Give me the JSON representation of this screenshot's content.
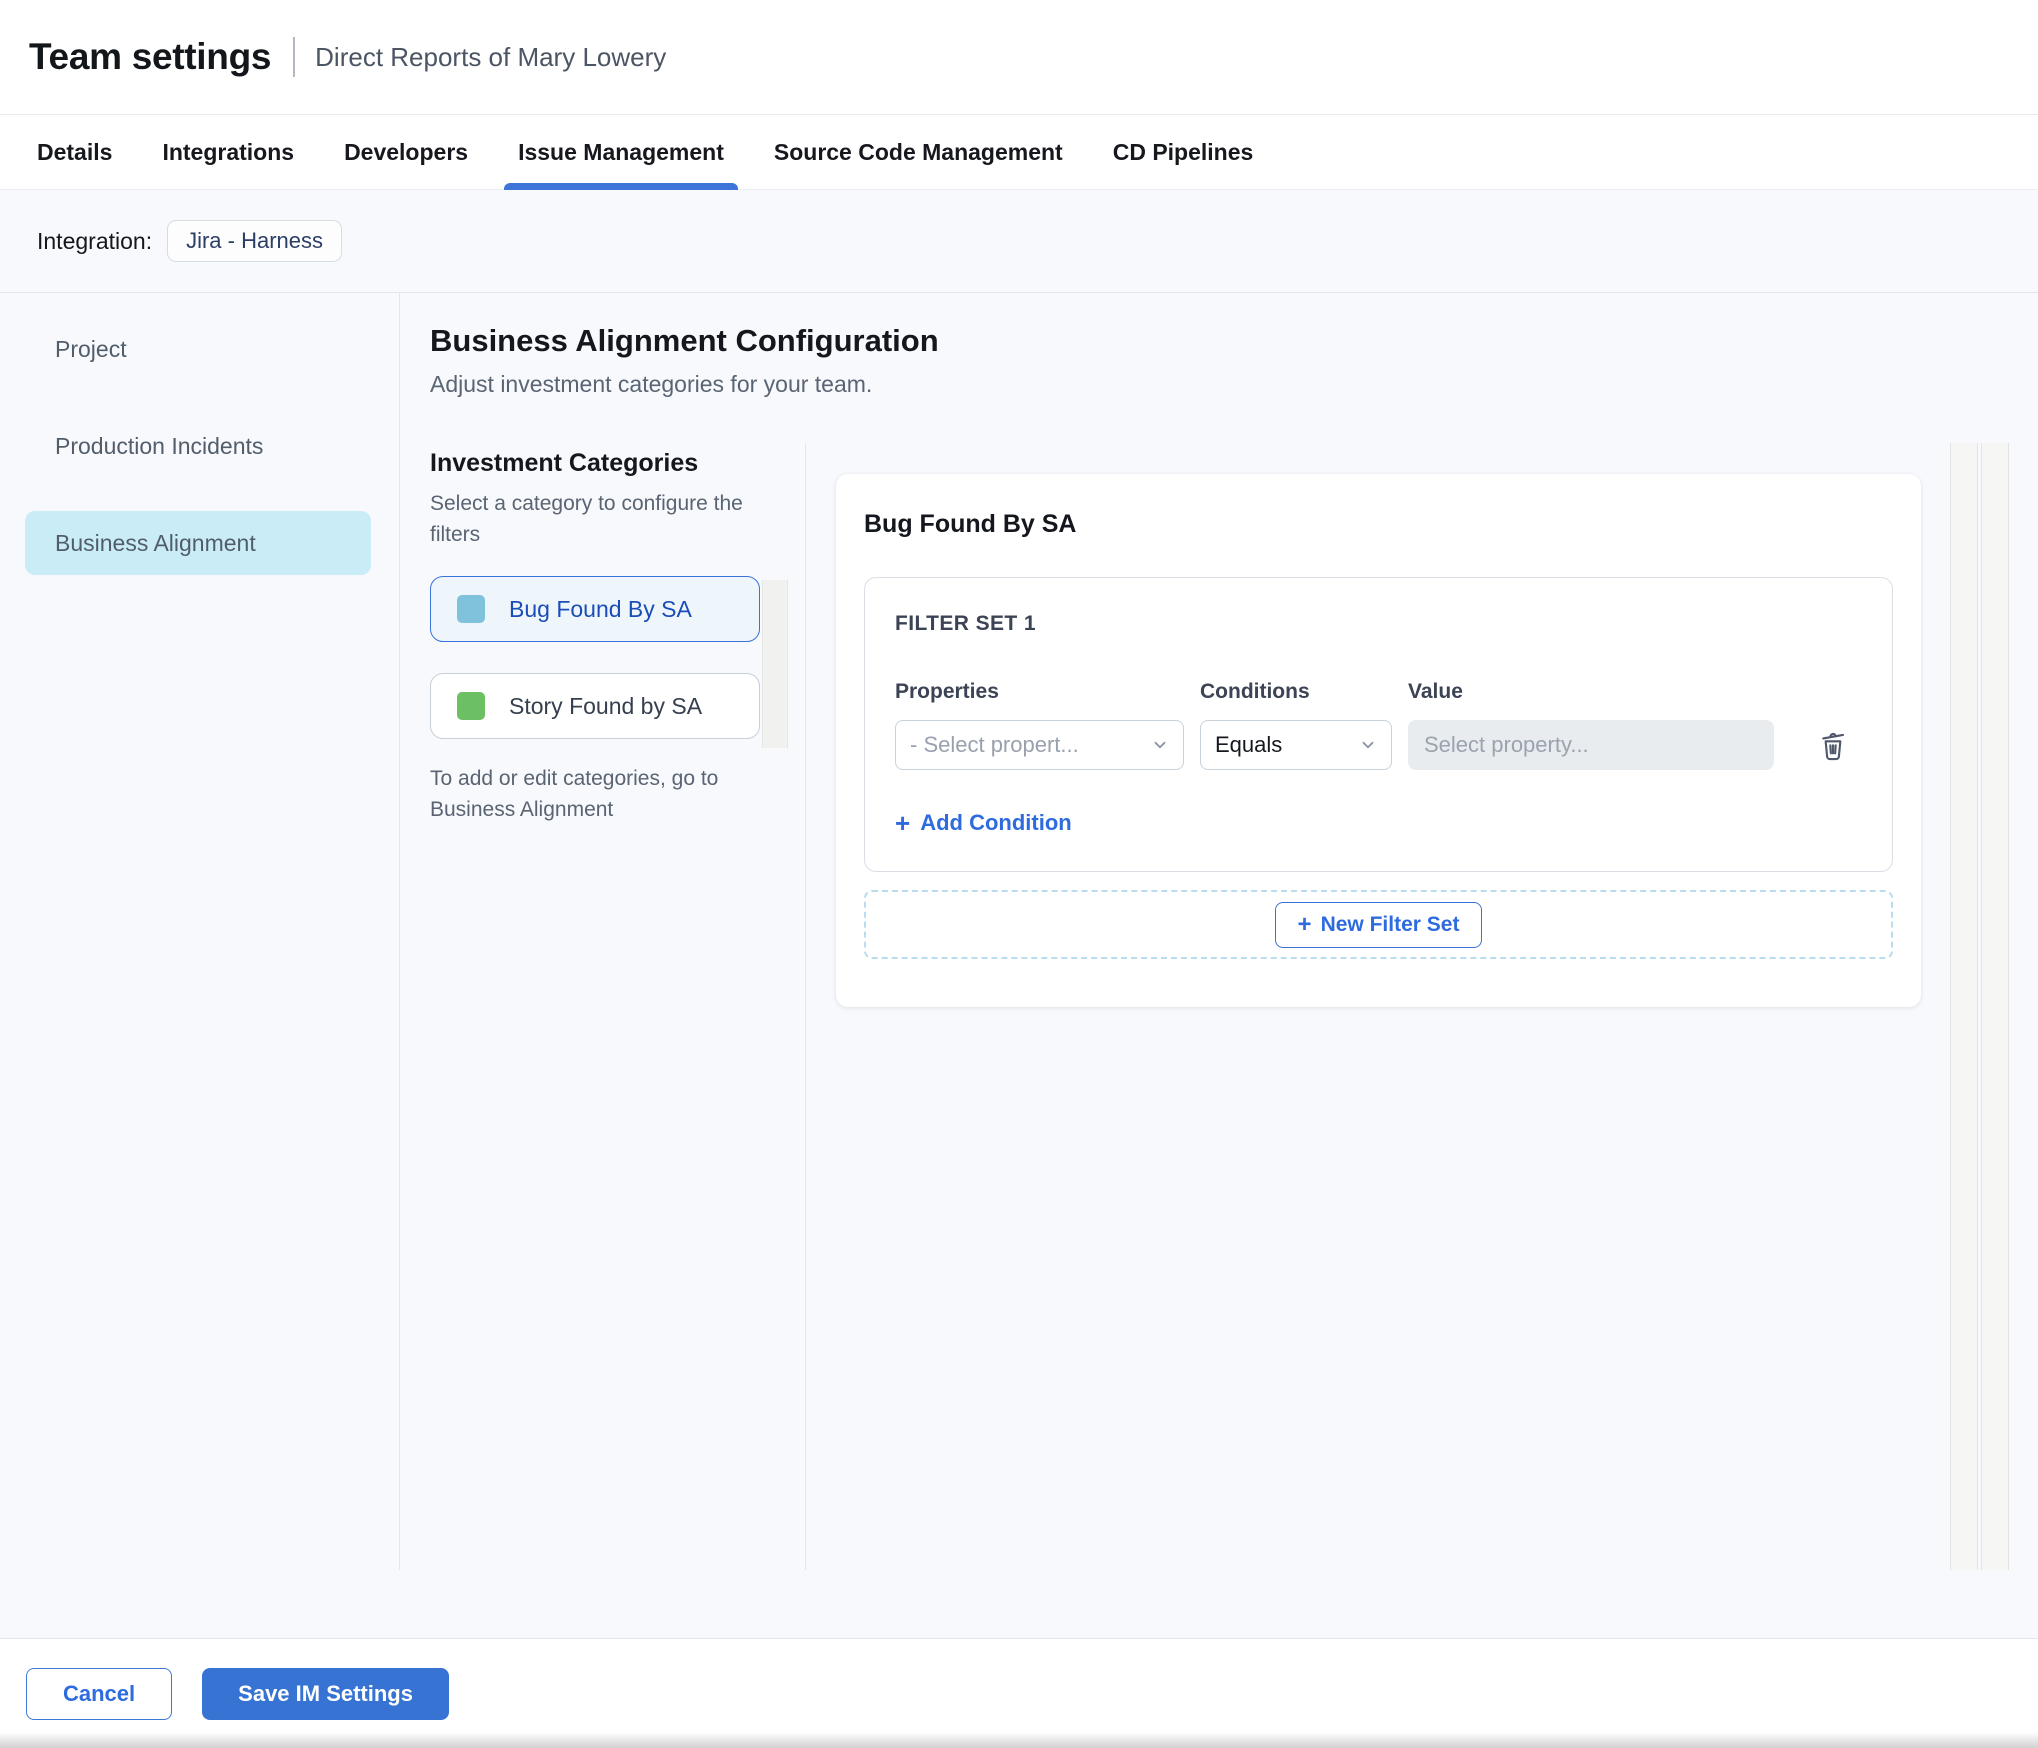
{
  "header": {
    "title": "Team settings",
    "subtitle": "Direct Reports of Mary Lowery"
  },
  "tabs": [
    {
      "label": "Details",
      "active": false
    },
    {
      "label": "Integrations",
      "active": false
    },
    {
      "label": "Developers",
      "active": false
    },
    {
      "label": "Issue Management",
      "active": true
    },
    {
      "label": "Source Code Management",
      "active": false
    },
    {
      "label": "CD Pipelines",
      "active": false
    }
  ],
  "integration": {
    "label": "Integration:",
    "chip": "Jira - Harness"
  },
  "sidebar": {
    "items": [
      {
        "label": "Project",
        "selected": false
      },
      {
        "label": "Production Incidents",
        "selected": false
      },
      {
        "label": "Business Alignment",
        "selected": true
      }
    ]
  },
  "main": {
    "title": "Business Alignment Configuration",
    "subtitle": "Adjust investment categories for your team.",
    "categories_panel": {
      "title": "Investment Categories",
      "helper": "Select a category to configure the filters",
      "items": [
        {
          "label": "Bug Found By SA",
          "swatch_color": "#80c2dc",
          "selected": true
        },
        {
          "label": "Story Found by SA",
          "swatch_color": "#6dbf63",
          "selected": false
        }
      ],
      "footnote": "To add or edit categories, go to Business Alignment"
    },
    "filter_panel": {
      "title": "Bug Found By SA",
      "filter_set": {
        "label": "FILTER SET 1",
        "columns": [
          "Properties",
          "Conditions",
          "Value"
        ],
        "row": {
          "property_placeholder": "- Select propert...",
          "condition_value": "Equals",
          "value_placeholder": "Select property..."
        },
        "add_condition_label": "Add Condition"
      },
      "new_filter_set_label": "New Filter Set"
    }
  },
  "footer": {
    "cancel_label": "Cancel",
    "save_label": "Save IM Settings"
  },
  "icons": {
    "plus": "+"
  },
  "colors": {
    "accent_blue": "#3d74d8",
    "link_blue": "#2e6bdf",
    "save_button_bg": "#3673d2",
    "sidebar_selected_bg": "#c9ecf7",
    "category_selected_bg": "#eef6fc",
    "category_blue_swatch": "#80c2dc",
    "category_green_swatch": "#6dbf63",
    "content_bg": "#f7f9fc",
    "value_input_bg": "#e8ecef"
  }
}
